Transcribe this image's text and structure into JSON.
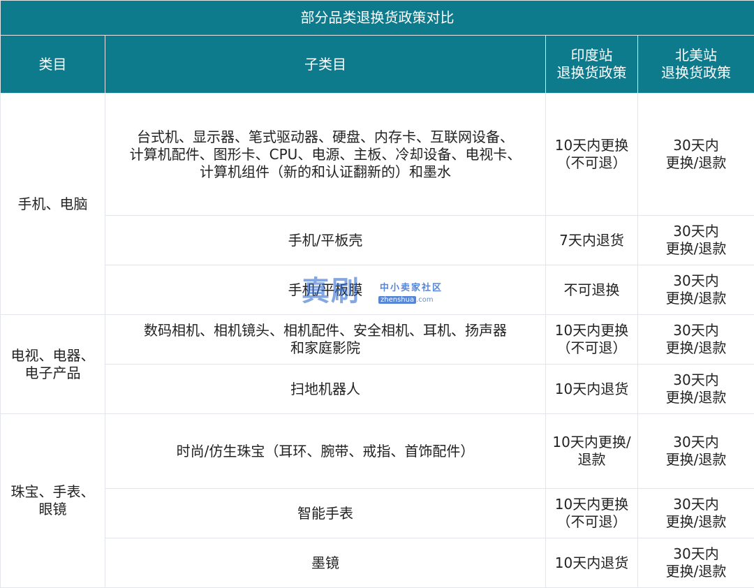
{
  "table": {
    "title": "部分品类退换货政策对比",
    "headers": {
      "category": "类目",
      "subcategory": "子类目",
      "india": "印度站\n退换货政策",
      "na": "北美站\n退换货政策"
    },
    "groups": [
      {
        "name": "手机、电脑",
        "rows": [
          {
            "sub": "台式机、显示器、笔式驱动器、硬盘、内存卡、互联网设备、\n计算机配件、图形卡、CPU、电源、主板、冷却设备、电视卡、\n计算机组件（新的和认证翻新的）和墨水",
            "india": "10天内更换\n（不可退）",
            "na": "30天内\n更换/退款"
          },
          {
            "sub": "手机/平板壳",
            "india": "7天内退货",
            "na": "30天内\n更换/退款"
          },
          {
            "sub": "手机/平板膜",
            "india": "不可退换",
            "na": "30天内\n更换/退款"
          }
        ]
      },
      {
        "name": "电视、电器、\n电子产品",
        "rows": [
          {
            "sub": "数码相机、相机镜头、相机配件、安全相机、耳机、扬声器\n和家庭影院",
            "india": "10天内更换\n（不可退）",
            "na": "30天内\n更换/退款"
          },
          {
            "sub": "扫地机器人",
            "india": "10天内退货",
            "na": "30天内\n更换/退款"
          }
        ]
      },
      {
        "name": "珠宝、手表、\n眼镜",
        "rows": [
          {
            "sub": "时尚/仿生珠宝（耳环、腕带、戒指、首饰配件）",
            "india": "10天内更换/\n退款",
            "na": "30天内\n更换/退款"
          },
          {
            "sub": "智能手表",
            "india": "10天内更换\n（不可退）",
            "na": "30天内\n更换/退款"
          },
          {
            "sub": "墨镜",
            "india": "10天内退货",
            "na": "30天内\n更换/退款"
          }
        ]
      }
    ]
  },
  "watermark": {
    "main": "真刷",
    "top": "中小卖家社区",
    "domain_box": "zhenshua",
    "domain_suffix": ".com"
  }
}
